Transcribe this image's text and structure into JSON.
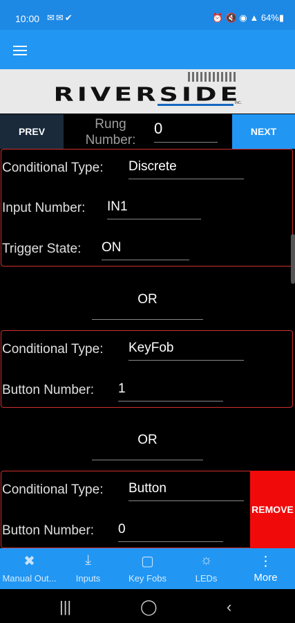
{
  "status_bar": {
    "time": "10:00",
    "left_icons": [
      "mail-icon",
      "mail-icon",
      "check-icon"
    ],
    "battery": "64%"
  },
  "logo": {
    "text": "RIVERSIDE",
    "small_text": "INC."
  },
  "nav": {
    "prev_label": "PREV",
    "next_label": "NEXT",
    "rung_label": "Rung Number:",
    "rung_value": "0"
  },
  "conditions": [
    {
      "rows": [
        {
          "label": "Conditional Type:",
          "value": "Discrete"
        },
        {
          "label": "Input Number:",
          "value": "IN1"
        },
        {
          "label": "Trigger State:",
          "value": "ON"
        }
      ]
    },
    {
      "rows": [
        {
          "label": "Conditional Type:",
          "value": "KeyFob"
        },
        {
          "label": "Button Number:",
          "value": "1"
        }
      ]
    },
    {
      "rows": [
        {
          "label": "Conditional Type:",
          "value": "Button"
        },
        {
          "label": "Button Number:",
          "value": "0"
        }
      ],
      "remove_label": "REMOVE"
    }
  ],
  "or_label": "OR",
  "tabs": [
    {
      "label": "Manual Out...",
      "icon": "tools-icon",
      "active": false
    },
    {
      "label": "Inputs",
      "icon": "download-icon",
      "active": false
    },
    {
      "label": "Key Fobs",
      "icon": "keyfob-icon",
      "active": false
    },
    {
      "label": "LEDs",
      "icon": "led-icon",
      "active": false
    },
    {
      "label": "More",
      "icon": "more-vert-icon",
      "active": true
    }
  ],
  "colors": {
    "primary": "#2196f3",
    "card_border": "#d32f2f",
    "remove": "#f10a0a"
  }
}
